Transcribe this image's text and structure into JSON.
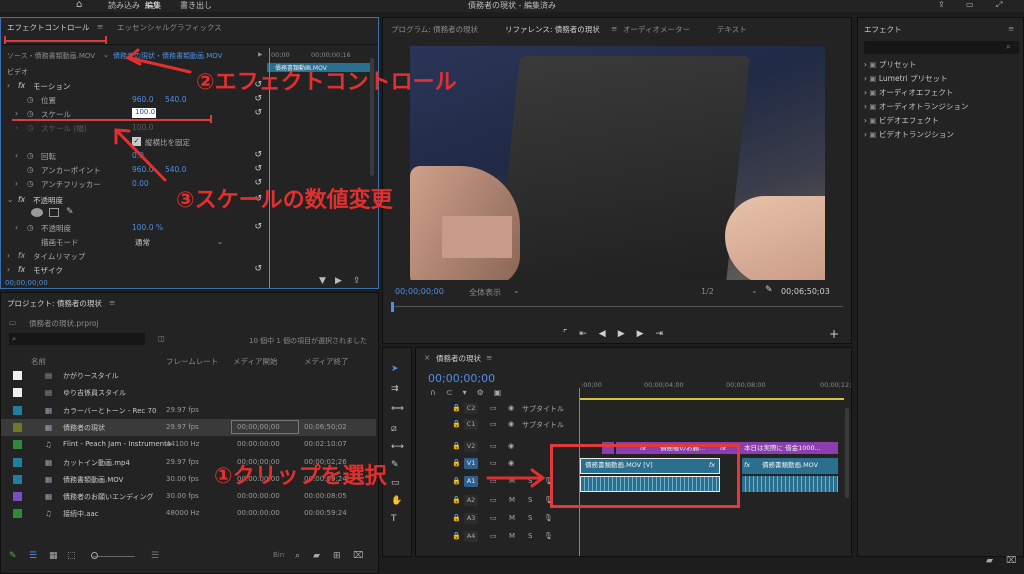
{
  "app": {
    "title": "債務者の現状 - 編集済み",
    "nav": {
      "home": "⌂",
      "import": "読み込み",
      "edit": "編集",
      "export": "書き出し"
    }
  },
  "effect_controls": {
    "tab_active": "エフェクトコントロール",
    "tab_other": "エッセンシャルグラフィックス",
    "source": "ソース・債務書類動画.MOV",
    "sequence_chip": "債務者の現状・債務書類動画.MOV",
    "mini_clip": "債務書類動画.MOV",
    "tc_start": "00;00",
    "tc_mid": "00;00;00;16",
    "section_video": "ビデオ",
    "motion": "モーション",
    "position_label": "位置",
    "position_x": "960.0",
    "position_y": "540.0",
    "scale_label": "スケール",
    "scale_value": "100.0",
    "scale_width_label": "スケール (幅)",
    "scale_width_value": "100.0",
    "uniform_scale": "縦横比を固定",
    "rotation_label": "回転",
    "rotation_value": "0.0",
    "anchor_label": "アンカーポイント",
    "anchor_x": "960.0",
    "anchor_y": "540.0",
    "antiflicker_label": "アンチフリッカー",
    "antiflicker_value": "0.00",
    "opacity": "不透明度",
    "opacity_label": "不透明度",
    "opacity_value": "100.0 %",
    "blend_label": "描画モード",
    "blend_value": "通常",
    "time_remap": "タイムリマップ",
    "mosaic": "モザイク",
    "timecode": "00;00;00;00"
  },
  "program_monitor": {
    "tab_program": "プログラム: 債務者の現状",
    "tab_reference": "リファレンス: 債務者の現状",
    "tab_audio": "オーディオメーター",
    "tab_text": "テキスト",
    "timecode": "00;00;00;00",
    "zoom": "全体表示",
    "resolution": "1/2",
    "duration": "00;06;50;03"
  },
  "effects_panel": {
    "title": "エフェクト",
    "items": [
      "プリセット",
      "Lumetri プリセット",
      "オーディオエフェクト",
      "オーディオトランジション",
      "ビデオエフェクト",
      "ビデオトランジション"
    ]
  },
  "project": {
    "title": "プロジェクト: 債務者の現状",
    "file": "債務者の現状.prproj",
    "selection_info": "10 個中 1 個の項目が選択されました",
    "columns": {
      "name": "名前",
      "fps": "フレームレート",
      "start": "メディア開始",
      "end": "メディア終了"
    },
    "items": [
      {
        "color": "#f0f0f0",
        "name": "かがりースタイル",
        "fps": "",
        "start": "",
        "end": ""
      },
      {
        "color": "#f0f0f0",
        "name": "ゆり吉係員スタイル",
        "fps": "",
        "start": "",
        "end": ""
      },
      {
        "color": "#1f7fa0",
        "name": "カラーバーとトーン - Rec 70",
        "fps": "29.97 fps",
        "start": "",
        "end": ""
      },
      {
        "color": "#6f7a26",
        "name": "債務者の現状",
        "fps": "29.97 fps",
        "start": "00;00;00;00",
        "end": "00;06;50;02"
      },
      {
        "color": "#2c8a3a",
        "name": "Flint - Peach Jam - Instrumenta",
        "fps": "44100 Hz",
        "start": "00:00:00:00",
        "end": "00:02:10:07"
      },
      {
        "color": "#1f7fa0",
        "name": "カットイン動画.mp4",
        "fps": "29.97 fps",
        "start": "00;00;00;00",
        "end": "00;00;02;26"
      },
      {
        "color": "#1f7fa0",
        "name": "債務書類動画.MOV",
        "fps": "30.00 fps",
        "start": "00:00:00:00",
        "end": "00:00:09:24"
      },
      {
        "color": "#7a4fc4",
        "name": "債務者のお願いエンディング",
        "fps": "30.00 fps",
        "start": "00:00:00:00",
        "end": "00:00:08:05"
      },
      {
        "color": "#2c8a3a",
        "name": "接続中.aac",
        "fps": "48000 Hz",
        "start": "00:00:00:00",
        "end": "00:00:59:24"
      }
    ]
  },
  "timeline": {
    "title": "債務者の現状",
    "timecode": "00;00;00;00",
    "ruler": [
      ":00;00",
      "00;00;04;00",
      "00;00;08;00",
      "00;00;12;"
    ],
    "subtitle_label": "サブタイトル",
    "track_names": {
      "c2": "C2",
      "c1": "C1",
      "v2": "V2",
      "v1": "V1",
      "a1": "A1",
      "a2": "A2",
      "a3": "A3",
      "a4": "A4"
    },
    "track_m": "M",
    "track_s": "S",
    "clips": {
      "v2_a": "債務者のお願...",
      "v2_b": "本日は実際に 借金1000...",
      "v1_a": "債務書類動画.MOV [V]",
      "v1_b": "債務書類動画.MOV",
      "fx": "fx"
    }
  },
  "annotations": {
    "one": "①クリップを選択",
    "two": "②エフェクトコントロール",
    "three": "③スケールの数値変更"
  },
  "colors": {
    "accent": "#4d8fe6",
    "annotation": "#e42f2f",
    "clip_video": "#2b6f8f",
    "clip_graphic": "#8b3fae",
    "playhead": "#4d8fe6"
  }
}
